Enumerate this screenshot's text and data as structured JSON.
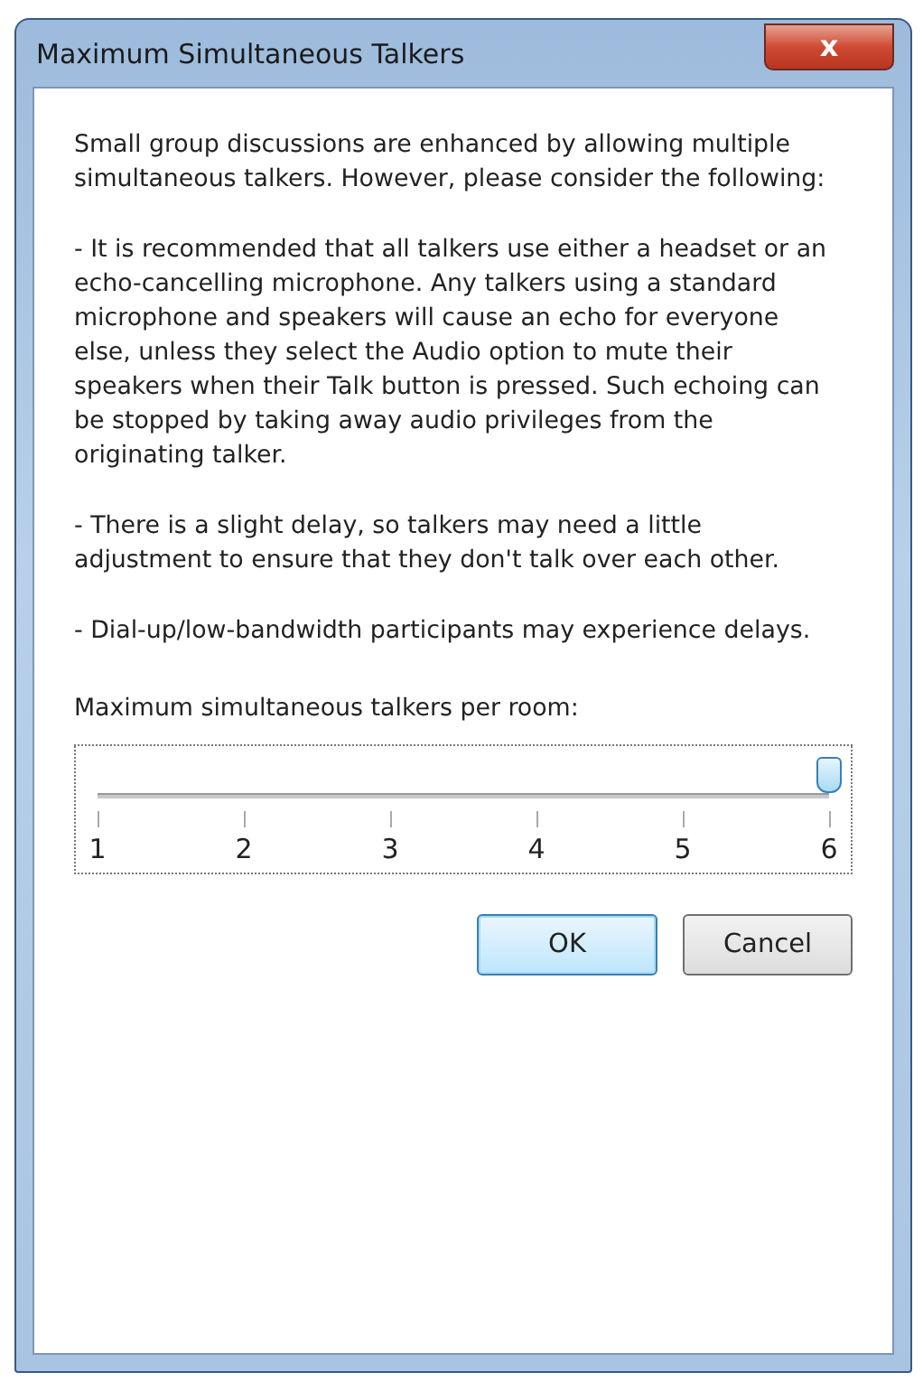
{
  "window": {
    "title": "Maximum Simultaneous Talkers",
    "close": "x"
  },
  "paragraphs": [
    "Small group discussions are enhanced by allowing multiple simultaneous talkers.  However, please consider the following:",
    "- It is recommended that all talkers use either a headset or an echo-cancelling microphone.  Any talkers using a standard microphone and speakers will cause an echo for everyone else, unless they select the Audio option to mute their speakers when their Talk button is pressed.  Such echoing can be stopped by taking away audio privileges from the originating talker.",
    "- There is a slight delay, so talkers may need a little adjustment to ensure that they don't talk over each other.",
    "- Dial-up/low-bandwidth participants may experience delays."
  ],
  "slider": {
    "label": "Maximum simultaneous talkers per room:",
    "level": 1,
    "ticks": [
      "1",
      "2",
      "3",
      "4",
      "5",
      "6"
    ]
  },
  "buttons": [
    {
      "label": "OK",
      "default": true
    },
    {
      "label": "Cancel",
      "default": false
    }
  ]
}
